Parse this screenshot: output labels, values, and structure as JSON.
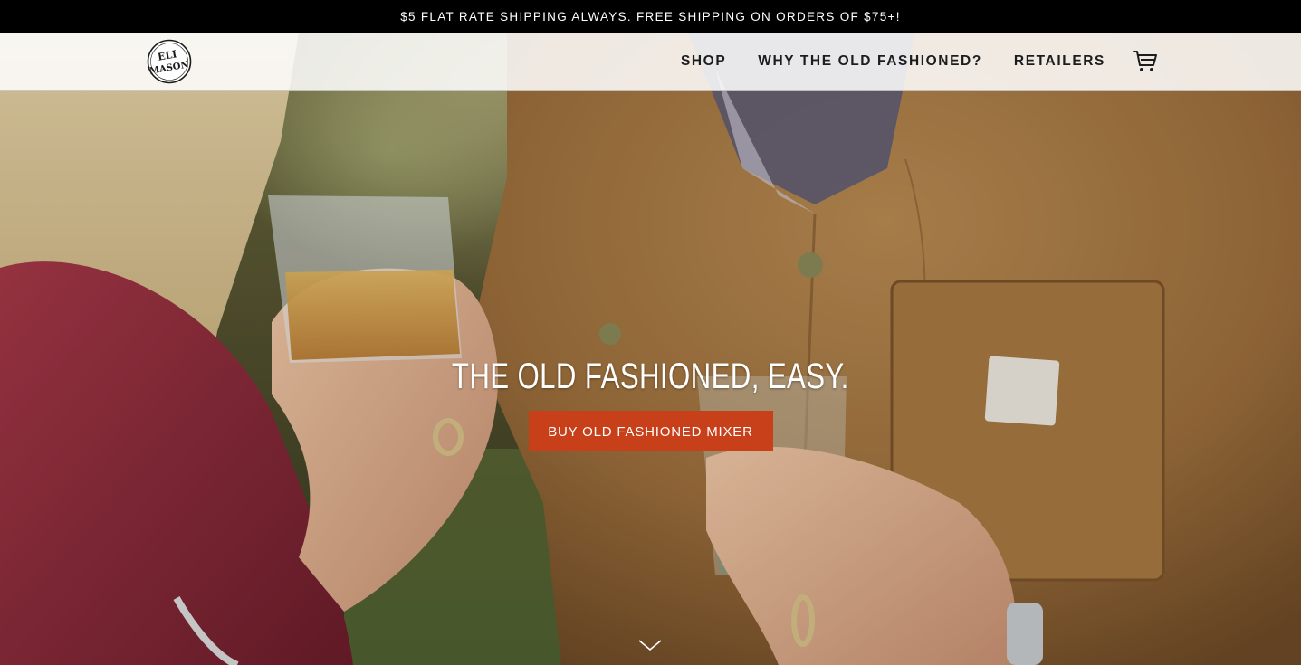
{
  "announcement": {
    "text": "$5 FLAT RATE SHIPPING ALWAYS. FREE SHIPPING ON ORDERS OF $75+!"
  },
  "header": {
    "logo_alt": "Eli Mason",
    "nav": [
      {
        "label": "SHOP"
      },
      {
        "label": "WHY THE OLD FASHIONED?"
      },
      {
        "label": "RETAILERS"
      }
    ],
    "cart_icon": "cart-icon"
  },
  "hero": {
    "title": "THE OLD FASHIONED, EASY.",
    "cta_label": "BUY OLD FASHIONED MIXER",
    "scroll_icon": "chevron-down-icon"
  },
  "colors": {
    "announcement_bg": "#000000",
    "cta_bg": "#c8401a",
    "header_bg": "#ffffff"
  }
}
